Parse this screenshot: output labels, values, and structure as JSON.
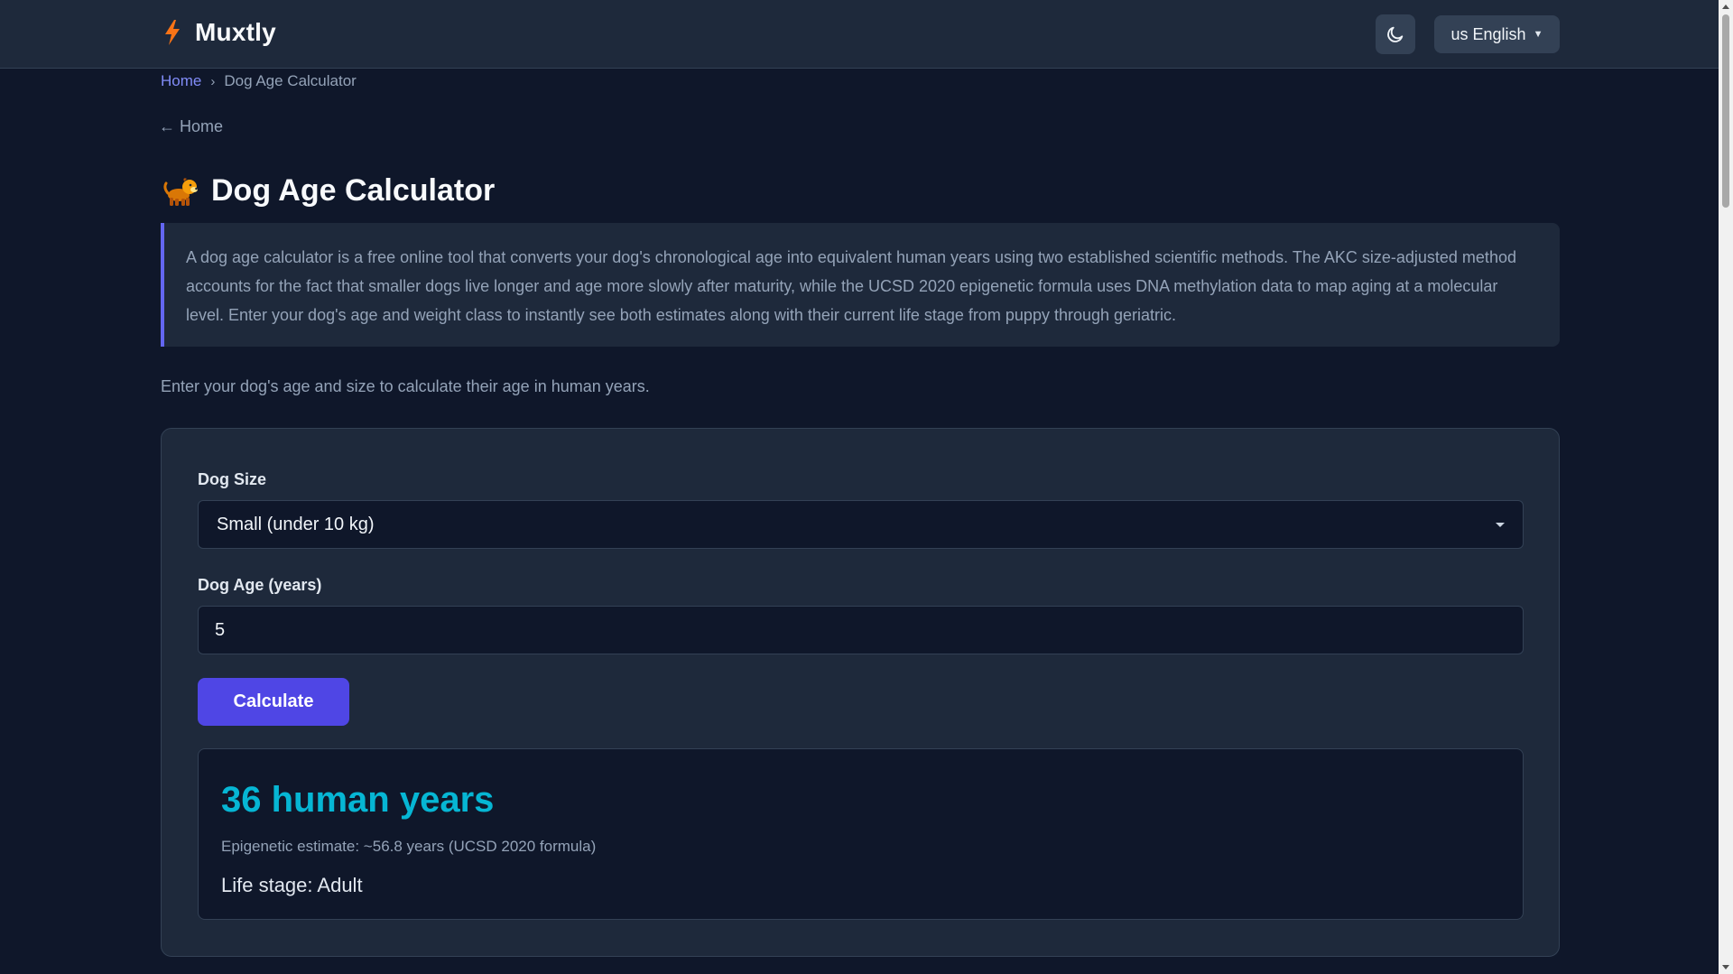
{
  "header": {
    "brand_name": "Muxtly",
    "brand_icon": "lightning-bolt-icon",
    "brand_color": "#f97316",
    "theme_toggle_icon": "moon-icon",
    "language_label": "us English",
    "language_caret_icon": "caret-down-icon"
  },
  "breadcrumb": {
    "home": "Home",
    "separator": "›",
    "current": "Dog Age Calculator"
  },
  "back_link": "← Home",
  "page": {
    "title": "Dog Age Calculator",
    "title_icon": "dog-icon",
    "intro": "A dog age calculator is a free online tool that converts your dog's chronological age into equivalent human years using two established scientific methods. The AKC size-adjusted method accounts for the fact that smaller dogs live longer and age more slowly after maturity, while the UCSD 2020 epigenetic formula uses DNA methylation data to map aging at a molecular level. Enter your dog's age and weight class to instantly see both estimates along with their current life stage from puppy through geriatric.",
    "instruction": "Enter your dog's age and size to calculate their age in human years."
  },
  "form": {
    "size_label": "Dog Size",
    "size_value": "Small (under 10 kg)",
    "age_label": "Dog Age (years)",
    "age_value": "5",
    "calculate_label": "Calculate"
  },
  "result": {
    "headline": "36 human years",
    "epigenetic": "Epigenetic estimate: ~56.8 years (UCSD 2020 formula)",
    "life_stage": "Life stage: Adult"
  },
  "colors": {
    "background": "#0f172a",
    "surface": "#1e293b",
    "accent": "#4f46e5",
    "result_highlight": "#06b6d4",
    "link": "#818cf8"
  }
}
